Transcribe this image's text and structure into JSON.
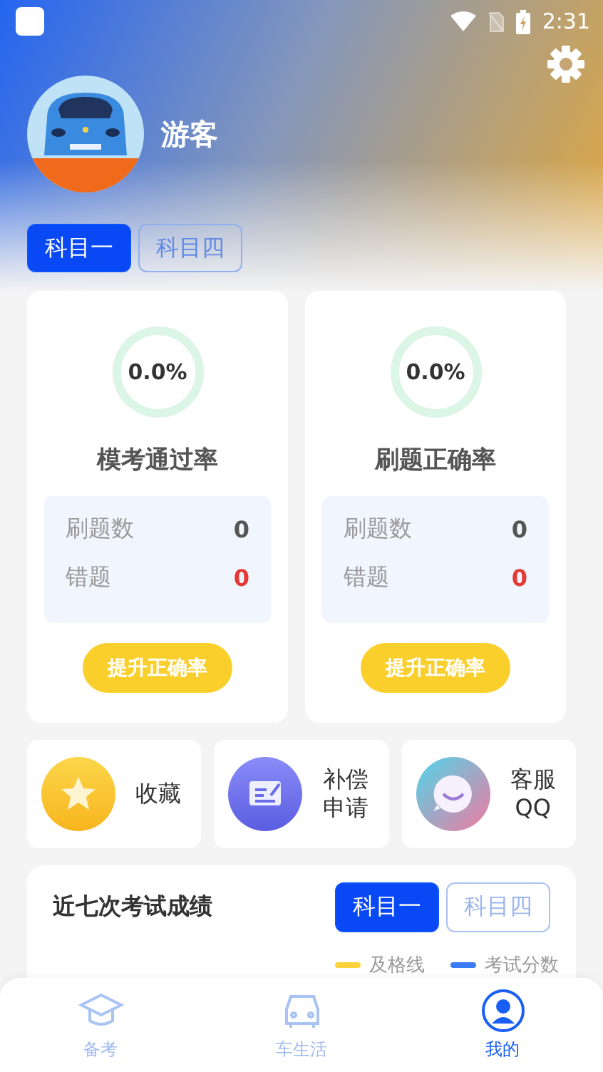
{
  "status_bar": {
    "time": "2:31"
  },
  "profile": {
    "name": "游客"
  },
  "subject_tabs": [
    {
      "label": "科目一",
      "selected": true
    },
    {
      "label": "科目四",
      "selected": false
    }
  ],
  "stat_cards": [
    {
      "percent": "0.0%",
      "title": "模考通过率",
      "rows": [
        {
          "label": "刷题数",
          "value": "0",
          "kind": "normal"
        },
        {
          "label": "错题",
          "value": "0",
          "kind": "error"
        }
      ],
      "button": "提升正确率"
    },
    {
      "percent": "0.0%",
      "title": "刷题正确率",
      "rows": [
        {
          "label": "刷题数",
          "value": "0",
          "kind": "normal"
        },
        {
          "label": "错题",
          "value": "0",
          "kind": "error"
        }
      ],
      "button": "提升正确率"
    }
  ],
  "shortcuts": [
    {
      "kind": "star",
      "lines": [
        "收藏"
      ]
    },
    {
      "kind": "form",
      "lines": [
        "补偿",
        "申请"
      ]
    },
    {
      "kind": "chat",
      "lines": [
        "客服",
        "QQ"
      ]
    }
  ],
  "scores": {
    "title": "近七次考试成绩",
    "tabs": [
      {
        "label": "科目一",
        "selected": true
      },
      {
        "label": "科目四",
        "selected": false
      }
    ],
    "legend": [
      {
        "label": "及格线",
        "color": "#fdd23a"
      },
      {
        "label": "考试分数",
        "color": "#3b7cf6"
      }
    ]
  },
  "bottom_nav": [
    {
      "kind": "cap",
      "label": "备考",
      "selected": false
    },
    {
      "kind": "car",
      "label": "车生活",
      "selected": false
    },
    {
      "kind": "person",
      "label": "我的",
      "selected": true
    }
  ]
}
